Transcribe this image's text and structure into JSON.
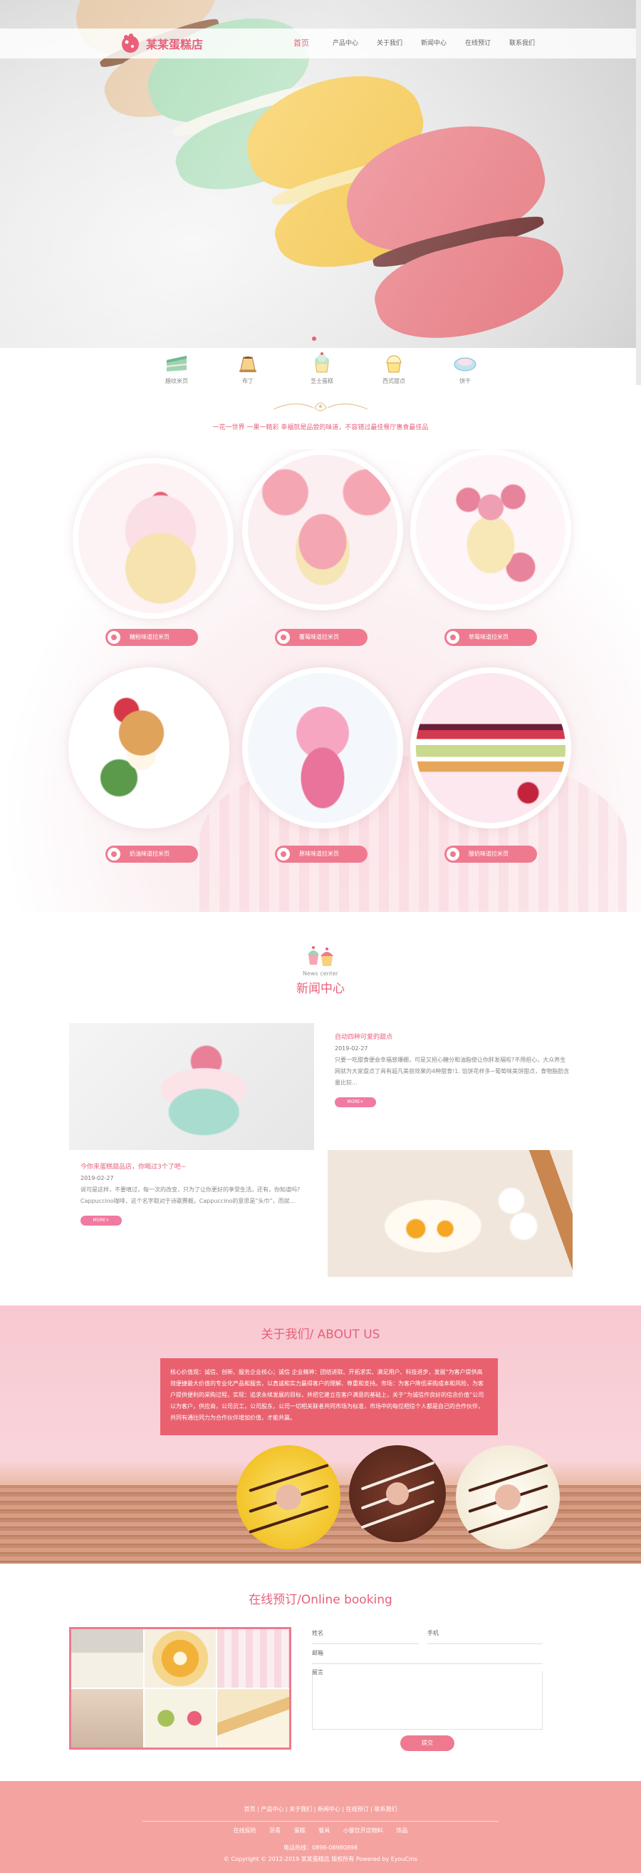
{
  "site": {
    "logo_text": "某某蛋糕店"
  },
  "nav": {
    "items": [
      {
        "label": "首页",
        "active": true
      },
      {
        "label": "产品中心"
      },
      {
        "label": "关于我们"
      },
      {
        "label": "新闻中心"
      },
      {
        "label": "在线预订"
      },
      {
        "label": "联系我们"
      }
    ]
  },
  "categories": [
    {
      "label": "腊纹米页",
      "icon": "cake-slice-icon"
    },
    {
      "label": "布丁",
      "icon": "pudding-icon"
    },
    {
      "label": "芝士蛋糕",
      "icon": "cheesecake-icon"
    },
    {
      "label": "西式甜点",
      "icon": "cupcake-icon"
    },
    {
      "label": "饼干",
      "icon": "cookie-icon"
    }
  ],
  "slogan": "一花一世界 一果一精彩 幸福就是品尝的味道，不容错过最佳餐厅惠食最佳品",
  "products": [
    {
      "label": "糖粉味道拉米页"
    },
    {
      "label": "覆莓味道拉米页"
    },
    {
      "label": "草莓味道拉米页"
    },
    {
      "label": "奶油味道拉米页"
    },
    {
      "label": "原味味道拉米页"
    },
    {
      "label": "酸奶味道拉米页"
    }
  ],
  "news": {
    "subtitle": "News center",
    "title": "新闻中心",
    "items": [
      {
        "title": "自动四种可爱的甜点",
        "date": "2019-02-27",
        "text": "只要一吃甜食便会幸福感爆棚，可是又担心糖分和油脂使让你胖发福啦?不用担心，大众养生网就为大家盘点了具有超凡美容效果的4种甜食!1. 馅饼花样多~葡萄味美饼甜点，食物脂肪含量比较...",
        "more": "MORE+"
      },
      {
        "title": "今你来蛋糕甜品店，你喝过3个了吧~",
        "date": "2019-02-27",
        "text": "说可是这样，不要嗔过，每一次的改变，只为了让你更好的享受生活。还有，你知道吗? Cappuccino咖啡，这个名字取对于诗歌赛概，Cappuccino的意思是“头巾”，而就...",
        "more": "MORE+"
      }
    ]
  },
  "about": {
    "title": "关于我们/ ABOUT US",
    "text": "核心价值观：诚信、创新、服务企业核心；诚信 企业精神：团结进取、开拓求实、满足用户、科技进步，发展“为客户提供高效便捷最大价值的专业化产品和服务，以真诚和实力赢得客户的理解、尊重和支持。市场：为客户降低采购成本和风险，为客户提供便利的采购过程，实现：追求永续发展的目标，并把它建立在客户满意的基础上，关于“为诚信作良好的信念价值”公司以为客户，供应商，公司员工，公司股东，公司一切相关联者共同市场为标准，市场中的每位相信个人都是自己的合作伙伴，共同有通往同力为合作伙伴增加价值，才能共赢。"
  },
  "booking": {
    "title": "在线预订/Online booking",
    "fields": {
      "name": "姓名",
      "phone": "手机",
      "email": "邮箱",
      "message": "留言"
    },
    "submit": "提交"
  },
  "footer": {
    "links": "首页 | 产品中心 | 关于我们 | 新闻中心 | 在线预订 | 联系我们",
    "tags": [
      "在线探险",
      "沥青",
      "蛋糕",
      "餐具",
      "小餐饮开店物料",
      "饰品"
    ],
    "phone": "电话热线：0898-08980898",
    "copyright": "© Copyright © 2012-2019 某某蛋糕店 版权所有 Powered by EyouCms"
  },
  "colors": {
    "accent": "#e8607a",
    "label_pink": "#ef7a8f",
    "footer": "#f5a3a0",
    "about_box": "#e9616f"
  }
}
